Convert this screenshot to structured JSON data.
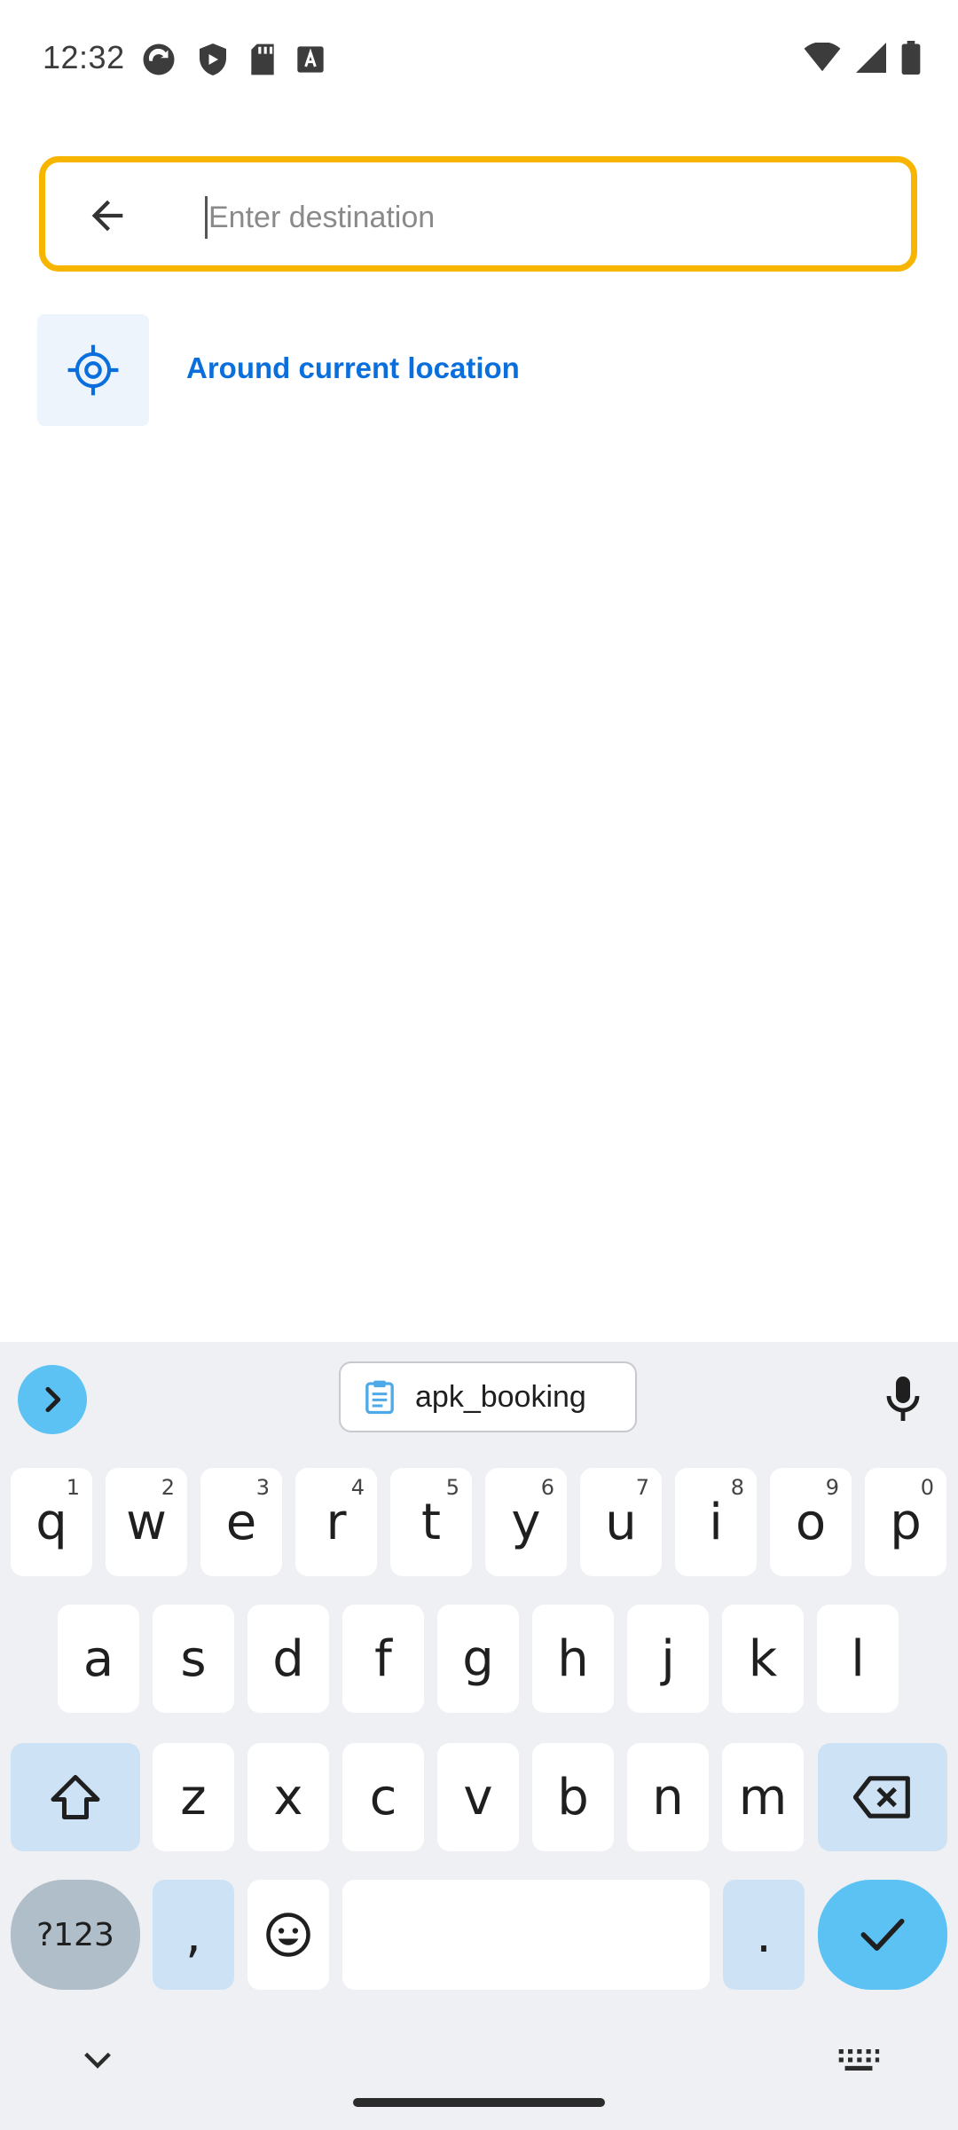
{
  "status_bar": {
    "time": "12:32",
    "left_icons": [
      "sync-icon",
      "shield-icon",
      "sd-card-icon",
      "font-a-icon"
    ],
    "right_icons": [
      "wifi-icon",
      "signal-icon",
      "battery-icon"
    ]
  },
  "search": {
    "placeholder": "Enter destination",
    "value": "",
    "border_color": "#f7b500"
  },
  "suggestions": [
    {
      "label": "Around current location",
      "icon": "gps-target-icon"
    }
  ],
  "keyboard": {
    "clipboard_chip": "apk_booking",
    "rows": [
      [
        {
          "char": "q",
          "hint": "1"
        },
        {
          "char": "w",
          "hint": "2"
        },
        {
          "char": "e",
          "hint": "3"
        },
        {
          "char": "r",
          "hint": "4"
        },
        {
          "char": "t",
          "hint": "5"
        },
        {
          "char": "y",
          "hint": "6"
        },
        {
          "char": "u",
          "hint": "7"
        },
        {
          "char": "i",
          "hint": "8"
        },
        {
          "char": "o",
          "hint": "9"
        },
        {
          "char": "p",
          "hint": "0"
        }
      ],
      [
        {
          "char": "a"
        },
        {
          "char": "s"
        },
        {
          "char": "d"
        },
        {
          "char": "f"
        },
        {
          "char": "g"
        },
        {
          "char": "h"
        },
        {
          "char": "j"
        },
        {
          "char": "k"
        },
        {
          "char": "l"
        }
      ],
      [
        {
          "char": "z"
        },
        {
          "char": "x"
        },
        {
          "char": "c"
        },
        {
          "char": "v"
        },
        {
          "char": "b"
        },
        {
          "char": "n"
        },
        {
          "char": "m"
        }
      ]
    ],
    "symbols_key": "?123",
    "comma_key": ",",
    "period_key": ".",
    "accent_color": "#5bc2f3"
  }
}
